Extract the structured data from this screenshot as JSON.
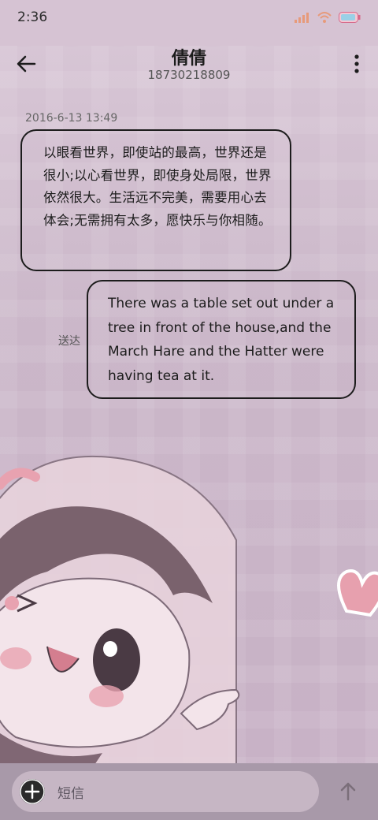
{
  "status_bar": {
    "time": "2:36"
  },
  "header": {
    "contact_name": "倩倩",
    "contact_number": "18730218809"
  },
  "messages": {
    "timestamp": "2016-6-13 13:49",
    "received": "以眼看世界，即使站的最高，世界还是很小;以心看世界，即使身处局限，世界依然很大。生活远不完美，需要用心去体会;无需拥有太多，愿快乐与你相随。",
    "sent": "There was a table set out under a tree in front of the house,and the March Hare and the Hatter were having tea at it.",
    "sent_status": "送达"
  },
  "composer": {
    "placeholder": "短信"
  },
  "icons": {
    "back": "arrow-left-icon",
    "more": "more-vertical-icon",
    "add": "plus-circle-icon",
    "send": "arrow-up-icon",
    "signal": "signal-icon",
    "wifi": "wifi-icon",
    "battery": "battery-icon"
  },
  "colors": {
    "background": "#cbb7c9",
    "bubble_border": "#1c1c1c",
    "composer": "#a899a9"
  }
}
